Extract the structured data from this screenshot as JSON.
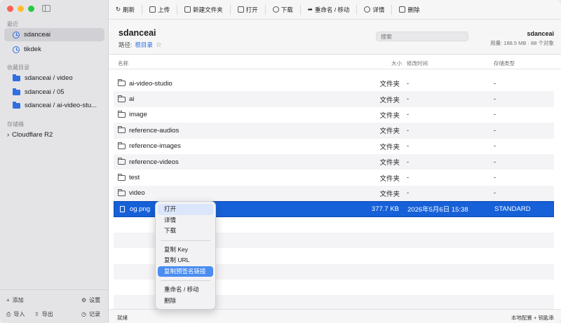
{
  "sidebar": {
    "section_recent": "最近",
    "recent": [
      {
        "label": "sdanceai"
      },
      {
        "label": "tikdek"
      }
    ],
    "section_favorites": "收藏目录",
    "favorites": [
      {
        "label": "sdanceai / video"
      },
      {
        "label": "sdanceai / 05"
      },
      {
        "label": "sdanceai / ai-video-stu..."
      }
    ],
    "section_storage": "存储桶",
    "storage_item": "Cloudflare R2",
    "footer": {
      "add": "添加",
      "settings": "设置",
      "import": "导入",
      "export": "导出",
      "logs": "记录"
    }
  },
  "toolbar": {
    "refresh": "刷新",
    "upload": "上传",
    "new_folder": "新建文件夹",
    "open": "打开",
    "download": "下载",
    "rename_move": "重命名 / 移动",
    "details": "详情",
    "delete": "删除"
  },
  "header": {
    "bucket": "sdanceai",
    "path_label": "路径:",
    "path_root": "根目录",
    "search_placeholder": "搜索",
    "account": "sdanceai",
    "usage": "用量: 188.5 MB · 88 个对象"
  },
  "columns": {
    "name": "名称",
    "size": "大小",
    "modified": "修改时间",
    "class": "存储类型"
  },
  "rows": [
    {
      "name": "ai-video-studio",
      "size": "文件夹",
      "modified": "-",
      "class": "-"
    },
    {
      "name": "ai",
      "size": "文件夹",
      "modified": "-",
      "class": "-"
    },
    {
      "name": "image",
      "size": "文件夹",
      "modified": "-",
      "class": "-"
    },
    {
      "name": "reference-audios",
      "size": "文件夹",
      "modified": "-",
      "class": "-"
    },
    {
      "name": "reference-images",
      "size": "文件夹",
      "modified": "-",
      "class": "-"
    },
    {
      "name": "reference-videos",
      "size": "文件夹",
      "modified": "-",
      "class": "-"
    },
    {
      "name": "test",
      "size": "文件夹",
      "modified": "-",
      "class": "-"
    },
    {
      "name": "video",
      "size": "文件夹",
      "modified": "-",
      "class": "-"
    },
    {
      "name": "og.png",
      "size": "377.7 KB",
      "modified": "2026年5月6日 15:38",
      "class": "STANDARD"
    }
  ],
  "context_menu": {
    "open": "打开",
    "details": "详情",
    "download": "下载",
    "copy_key": "复制 Key",
    "copy_url": "复制 URL",
    "copy_presigned": "复制预签名链接",
    "rename_move": "重命名 / 移动",
    "delete": "删除"
  },
  "status": {
    "left": "就绪",
    "right": "本地配置 + 钥匙串"
  }
}
